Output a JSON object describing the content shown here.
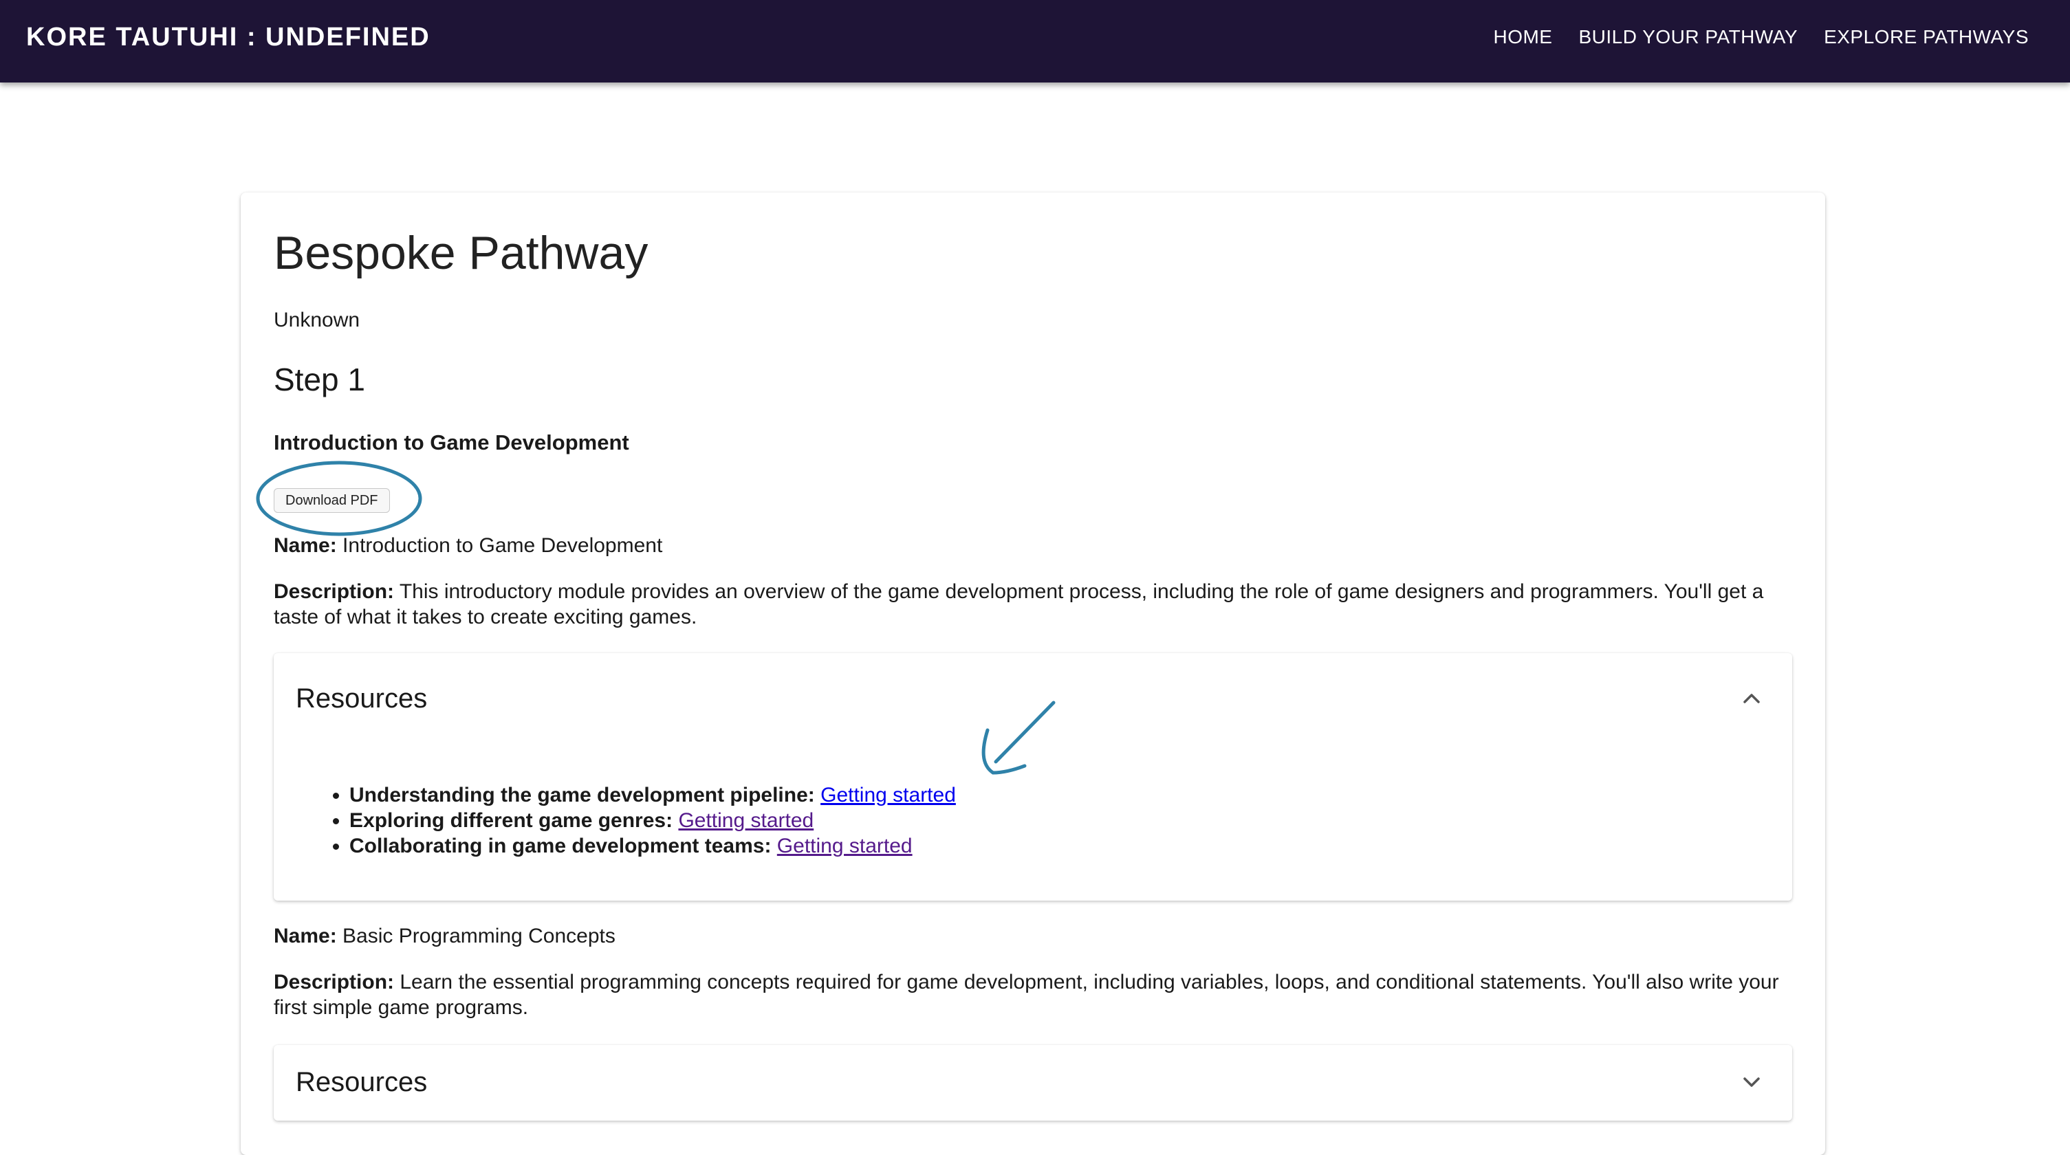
{
  "header": {
    "brand": "KORE TAUTUHI : UNDEFINED",
    "nav": [
      {
        "label": "HOME"
      },
      {
        "label": "BUILD YOUR PATHWAY"
      },
      {
        "label": "EXPLORE PATHWAYS"
      }
    ]
  },
  "colors": {
    "appbar": "#1e1436",
    "link": "#0000ee",
    "link_visited": "#551a8b",
    "annotation": "#2f82a9"
  },
  "page": {
    "title": "Bespoke Pathway",
    "subtitle": "Unknown",
    "step_title": "Step 1",
    "module_heading": "Introduction to Game Development",
    "download_button": "Download PDF"
  },
  "modules": [
    {
      "name_label": "Name:",
      "name": "Introduction to Game Development",
      "description_label": "Description:",
      "description": "This introductory module provides an overview of the game development process, including the role of game designers and programmers. You'll get a taste of what it takes to create exciting games.",
      "resources": {
        "title": "Resources",
        "expanded": true,
        "items": [
          {
            "label": "Understanding the game development pipeline:",
            "link": "Getting started",
            "visited": false
          },
          {
            "label": "Exploring different game genres:",
            "link": "Getting started",
            "visited": true
          },
          {
            "label": "Collaborating in game development teams:",
            "link": "Getting started",
            "visited": true
          }
        ]
      }
    },
    {
      "name_label": "Name:",
      "name": "Basic Programming Concepts",
      "description_label": "Description:",
      "description": "Learn the essential programming concepts required for game development, including variables, loops, and conditional statements. You'll also write your first simple game programs.",
      "resources": {
        "title": "Resources",
        "expanded": false
      }
    }
  ],
  "annotations": {
    "download_circle": "circle-highlight",
    "resource_arrow": "arrow-pointer"
  }
}
